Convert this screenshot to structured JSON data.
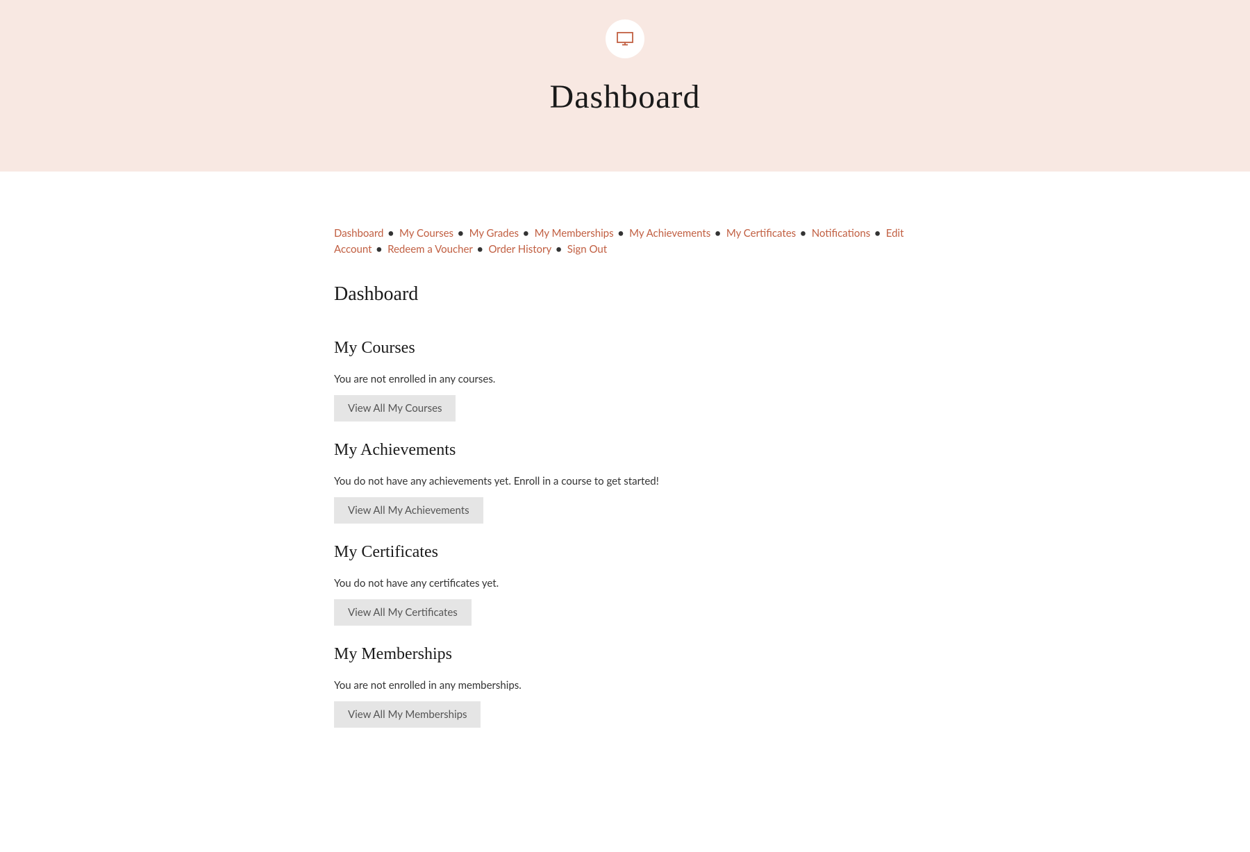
{
  "hero": {
    "title": "Dashboard"
  },
  "nav": {
    "dashboard": "Dashboard",
    "my_courses": "My Courses",
    "my_grades": "My Grades",
    "my_memberships": "My Memberships",
    "my_achievements": "My Achievements",
    "my_certificates": "My Certificates",
    "notifications": "Notifications",
    "edit_account": "Edit Account",
    "redeem_voucher": "Redeem a Voucher",
    "order_history": "Order History",
    "sign_out": "Sign Out"
  },
  "page": {
    "title": "Dashboard"
  },
  "sections": {
    "courses": {
      "title": "My Courses",
      "empty_text": "You are not enrolled in any courses.",
      "button": "View All My Courses"
    },
    "achievements": {
      "title": "My Achievements",
      "empty_text": "You do not have any achievements yet. Enroll in a course to get started!",
      "button": "View All My Achievements"
    },
    "certificates": {
      "title": "My Certificates",
      "empty_text": "You do not have any certificates yet.",
      "button": "View All My Certificates"
    },
    "memberships": {
      "title": "My Memberships",
      "empty_text": "You are not enrolled in any memberships.",
      "button": "View All My Memberships"
    }
  }
}
